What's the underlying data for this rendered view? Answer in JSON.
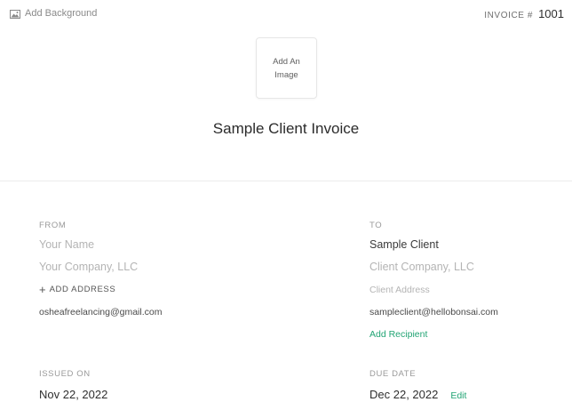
{
  "header": {
    "add_background_label": "Add Background",
    "invoice_label": "INVOICE #",
    "invoice_number": "1001",
    "add_image_label": "Add An Image",
    "title": "Sample Client Invoice"
  },
  "from": {
    "caption": "FROM",
    "name_placeholder": "Your Name",
    "company_placeholder": "Your Company, LLC",
    "add_address_label": "ADD ADDRESS",
    "email": "osheafreelancing@gmail.com"
  },
  "to": {
    "caption": "TO",
    "name": "Sample Client",
    "company_placeholder": "Client Company, LLC",
    "address_placeholder": "Client Address",
    "email": "sampleclient@hellobonsai.com",
    "add_recipient_label": "Add Recipient"
  },
  "dates": {
    "issued_caption": "ISSUED ON",
    "issued_value": "Nov 22, 2022",
    "due_caption": "DUE DATE",
    "due_value": "Dec 22, 2022",
    "edit_label": "Edit"
  },
  "colors": {
    "accent_green": "#22a474",
    "placeholder": "#b4b4b4",
    "caption": "#9a9a9a"
  },
  "icons": {
    "add_background": "image-icon",
    "add_address": "plus-icon"
  }
}
